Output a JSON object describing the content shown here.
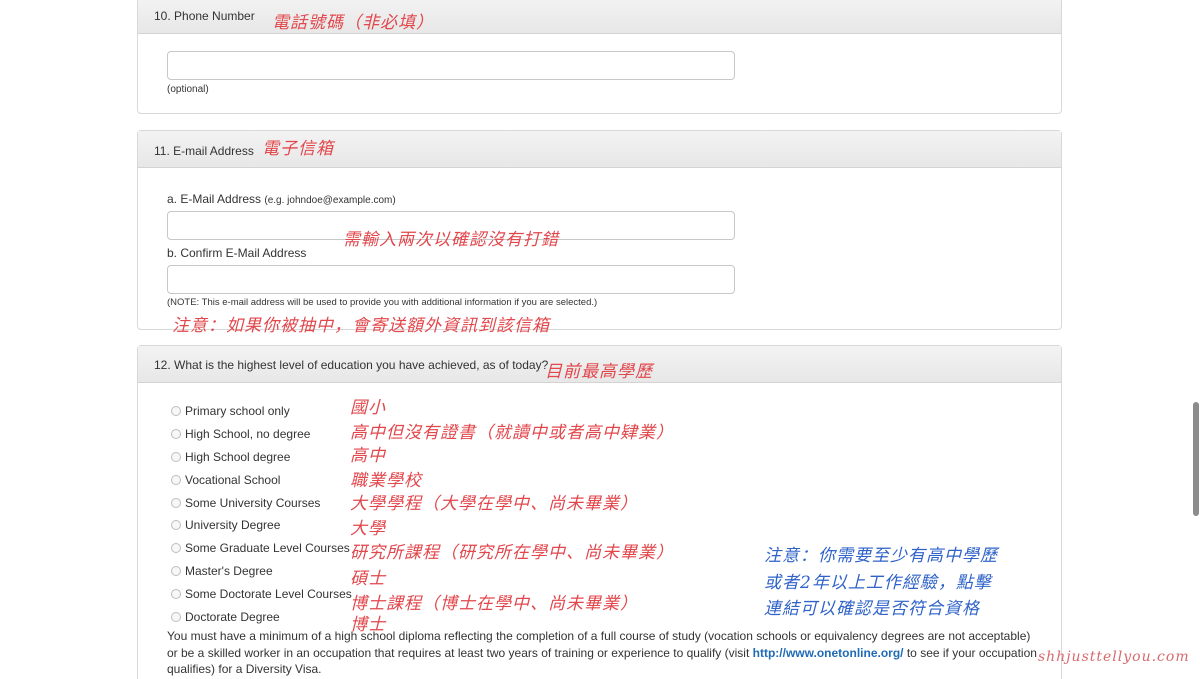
{
  "q10": {
    "title": "10. Phone Number",
    "note_zh": "電話號碼（非必填）",
    "input_value": "",
    "optional": "(optional)"
  },
  "q11": {
    "title": "11. E-mail Address",
    "note_zh": "電子信箱",
    "label_a": "a. E-Mail Address",
    "hint_a": "(e.g. johndoe@example.com)",
    "input_a": "",
    "note_mid_zh": "需輸入兩次以確認沒有打錯",
    "label_b": "b. Confirm E-Mail Address",
    "input_b": "",
    "notice": "(NOTE: This e-mail address will be used to provide you with additional information if you are selected.)",
    "notice_zh": "注意：如果你被抽中，會寄送額外資訊到該信箱"
  },
  "q12": {
    "title": "12. What is the highest level of education you have achieved, as of today?",
    "note_zh": "目前最高學歷",
    "options": [
      {
        "label": "Primary school only",
        "zh": "國小"
      },
      {
        "label": "High School, no degree",
        "zh": "高中但沒有證書（就讀中或者高中肄業）"
      },
      {
        "label": "High School degree",
        "zh": "高中"
      },
      {
        "label": "Vocational School",
        "zh": "職業學校"
      },
      {
        "label": "Some University Courses",
        "zh": "大學學程（大學在學中、尚未畢業）"
      },
      {
        "label": "University Degree",
        "zh": "大學"
      },
      {
        "label": "Some Graduate Level Courses",
        "zh": "研究所課程（研究所在學中、尚未畢業）"
      },
      {
        "label": "Master's Degree",
        "zh": "碩士"
      },
      {
        "label": "Some Doctorate Level Courses",
        "zh": "博士課程（博士在學中、尚未畢業）"
      },
      {
        "label": "Doctorate Degree",
        "zh": "博士"
      }
    ],
    "side_note_lines": [
      "注意：你需要至少有高中學歷",
      "或者2年以上工作經驗，點擊",
      "連結可以確認是否符合資格"
    ],
    "para_before": "You must have a minimum of a high school diploma reflecting the completion of a full course of study (vocation schools or equivalency degrees are not acceptable) or be a skilled worker in an occupation that requires at least two years of training or experience to qualify (visit ",
    "link": "http://www.onetonline.org/",
    "para_after": " to see if your occupation qualifies) for a Diversity Visa."
  },
  "watermark": "shhjusttellyou.com",
  "colors": {
    "annotation_red": "#e2474c",
    "annotation_blue": "#2f63c9",
    "link": "#1f6bb5"
  }
}
